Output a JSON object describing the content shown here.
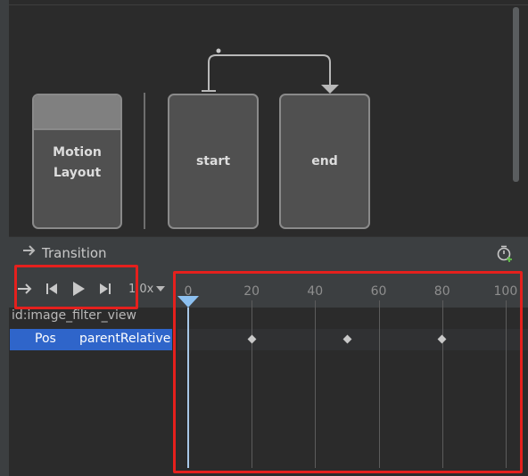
{
  "design": {
    "cards": {
      "motion_layout": "Motion\nLayout",
      "start": "start",
      "end": "end"
    }
  },
  "transition": {
    "label": "Transition",
    "arrow_icon": "arrow-right-icon",
    "timer_icon": "stopwatch-add-icon"
  },
  "controls": {
    "icons": [
      "loop-arrow-icon",
      "skip-to-start-icon",
      "play-icon",
      "skip-to-end-icon"
    ],
    "speed": "1.0x"
  },
  "timeline": {
    "ticks": [
      "0",
      "20",
      "40",
      "60",
      "80",
      "100"
    ],
    "playhead_position": 0,
    "keyframes": [
      20,
      50,
      80
    ]
  },
  "list": {
    "view_id": "id:image_filter_view",
    "selected_row": {
      "type": "Pos",
      "mode": "parentRelative"
    }
  },
  "colors": {
    "selection": "#2f65ca",
    "annotation_red": "#e5201d",
    "playhead": "#8cc0f0"
  }
}
